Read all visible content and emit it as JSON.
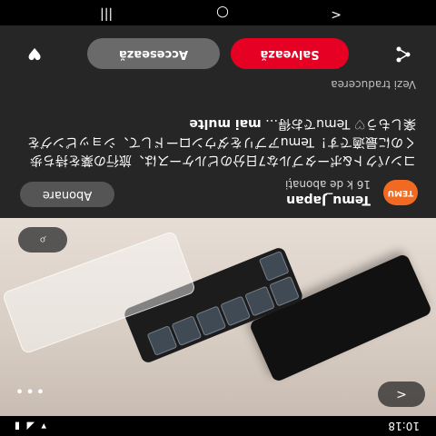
{
  "status_bar": {
    "time": "10:18",
    "icons": "▾ ◢ ▮"
  },
  "photo": {
    "back_label": "<",
    "more_label": "•••",
    "scan_label": "⌕"
  },
  "creator": {
    "avatar_text": "TEMU",
    "name": "Temu_Japan",
    "followers": "16 k de abonați",
    "subscribe_label": "Abonare"
  },
  "pin": {
    "description": "コンパクト&ポータブルな7日分のピルケースは、旅行の薬を持ち歩くのに最適です！Temuアプリをダウンロードして、ショッピングを楽しもう♡ Temuでお得…",
    "more_label": "mai multe",
    "translate_label": "Vezi traducerea"
  },
  "actions": {
    "save_label": "Salvează",
    "visit_label": "Accesează"
  },
  "nav_bar": {
    "back": "<",
    "home": "○",
    "recents": "|||"
  }
}
